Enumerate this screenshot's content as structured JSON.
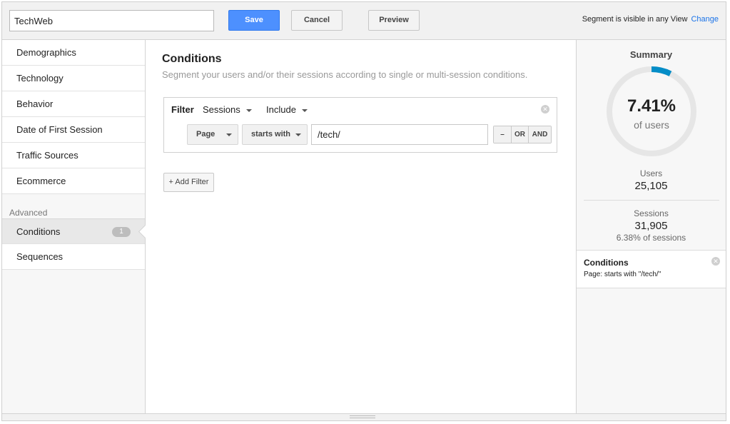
{
  "header": {
    "segment_name": "TechWeb",
    "save_label": "Save",
    "cancel_label": "Cancel",
    "preview_label": "Preview",
    "visibility_text": "Segment is visible in any View",
    "change_label": "Change"
  },
  "sidebar": {
    "items": [
      {
        "label": "Demographics"
      },
      {
        "label": "Technology"
      },
      {
        "label": "Behavior"
      },
      {
        "label": "Date of First Session"
      },
      {
        "label": "Traffic Sources"
      },
      {
        "label": "Ecommerce"
      }
    ],
    "advanced_label": "Advanced",
    "advanced_items": [
      {
        "label": "Conditions",
        "count": "1",
        "active": true
      },
      {
        "label": "Sequences"
      }
    ]
  },
  "main": {
    "title": "Conditions",
    "subtitle": "Segment your users and/or their sessions according to single or multi-session conditions.",
    "filter": {
      "label": "Filter",
      "scope": "Sessions",
      "mode": "Include",
      "dimension": "Page",
      "operator": "starts with",
      "value": "/tech/",
      "remove_symbol": "–",
      "or_label": "OR",
      "and_label": "AND"
    },
    "add_filter_label": "+ Add Filter"
  },
  "summary": {
    "title": "Summary",
    "percent_text": "7.41%",
    "percent_value": 7.41,
    "percent_sub": "of users",
    "users_label": "Users",
    "users_value": "25,105",
    "sessions_label": "Sessions",
    "sessions_value": "31,905",
    "sessions_note": "6.38% of sessions",
    "condition_title": "Conditions",
    "condition_desc": "Page: starts with \"/tech/\""
  },
  "colors": {
    "accent": "#4d90fe",
    "donut_fill": "#058dc7",
    "donut_track": "#e6e6e6"
  }
}
